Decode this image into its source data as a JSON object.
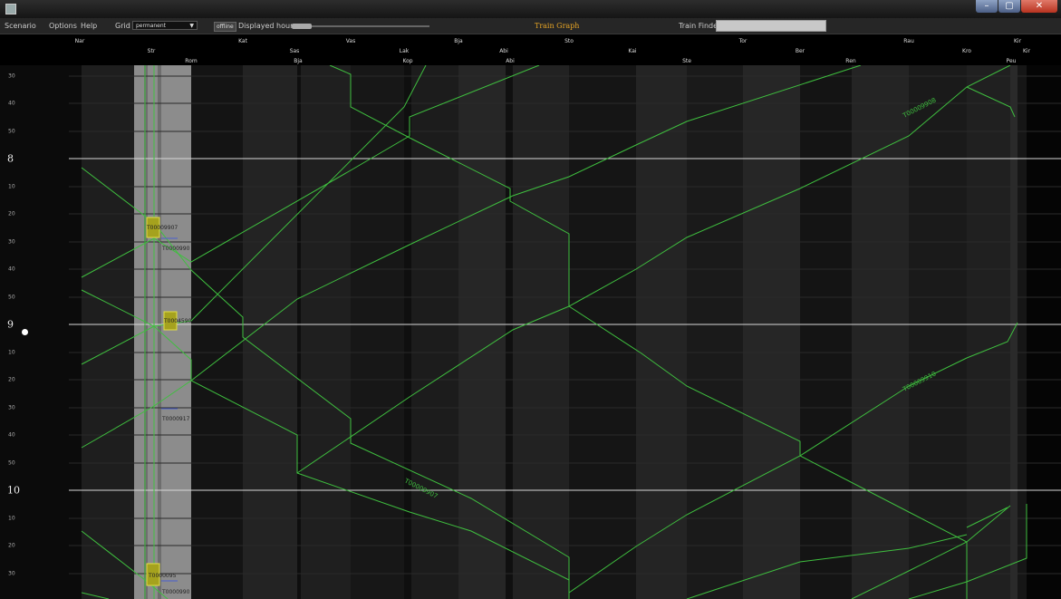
{
  "menu": {
    "scenario": "Scenario",
    "options": "Options",
    "help": "Help",
    "grid_label": "Grid",
    "grid_value": "permanent",
    "offline": "offline",
    "displayed_hours": "Displayed hours",
    "title": "Train Graph",
    "train_finder": "Train Finder",
    "train_finder_value": ""
  },
  "stations": {
    "row1": [
      "Nar",
      "Kat",
      "Vas",
      "Bja",
      "Sto",
      "Tor",
      "Rau",
      "Kir"
    ],
    "row2": [
      "Str",
      "Sas",
      "Lak",
      "Abi",
      "Kai",
      "Ber",
      "Kro",
      "Kir"
    ],
    "row3": [
      "Rom",
      "Bja",
      "Kop",
      "Abi",
      "Ste",
      "Ren",
      "Peu"
    ]
  },
  "axis": {
    "minute_labels": [
      "30",
      "40",
      "50",
      "8",
      "10",
      "20",
      "30",
      "40",
      "50",
      "9",
      "10",
      "20",
      "30",
      "40",
      "50",
      "10",
      "10",
      "20",
      "30"
    ],
    "hour_labels": [
      "8",
      "9",
      "10"
    ]
  },
  "trains": [
    "T00009907",
    "T0000990",
    "T0004590",
    "T0000917",
    "T00009908",
    "T00009910",
    "T00009907",
    "T0000095",
    "T0000990"
  ],
  "colors": {
    "train_line": "#3fbf3f",
    "accent_title": "#e6a425",
    "hour_line": "#d8d8d8",
    "selected_column": "#9a9a9a",
    "stop_box": "#a5a21e"
  }
}
